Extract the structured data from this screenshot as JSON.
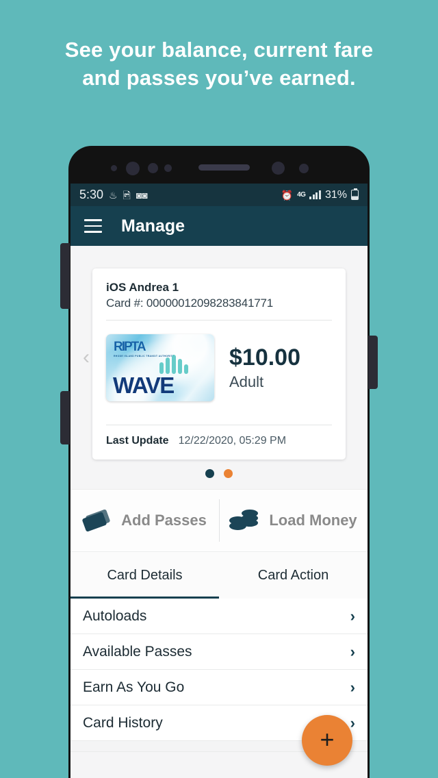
{
  "promo": {
    "line1": "See your balance, current fare",
    "line2": "and passes you’ve earned.",
    "background_color": "#5fb9ba"
  },
  "status_bar": {
    "time": "5:30",
    "left_icons": [
      "hotspot-icon",
      "image-icon",
      "incognito-icon"
    ],
    "alarm_icon": "alarm-icon",
    "network": "4G",
    "signal_icon": "signal-bars-icon",
    "battery_percent": "31%"
  },
  "app_bar": {
    "menu_icon": "hamburger-menu-icon",
    "title": "Manage",
    "background_color": "#16404f"
  },
  "card": {
    "name": "iOS Andrea 1",
    "number_label": "Card #: 00000012098283841771",
    "art": {
      "brand": "RIPTA",
      "brand_subtitle": "RHODE ISLAND PUBLIC TRANSIT AUTHORITY",
      "wordmark": "WAVE"
    },
    "balance": "$10.00",
    "fare_type": "Adult",
    "last_update_label": "Last Update",
    "last_update_value": "12/22/2020, 05:29 PM",
    "prev_arrow": "chevron-left-icon"
  },
  "pager": {
    "dots": [
      {
        "state": "inactive",
        "color": "#16404f"
      },
      {
        "state": "active",
        "color": "#ea8234"
      }
    ]
  },
  "actions": [
    {
      "label": "Add Passes",
      "icon": "ticket-icon"
    },
    {
      "label": "Load Money",
      "icon": "coins-icon"
    }
  ],
  "tabs": [
    {
      "label": "Card Details",
      "active": true
    },
    {
      "label": "Card Action",
      "active": false
    }
  ],
  "list": [
    {
      "label": "Autoloads",
      "chevron": "›"
    },
    {
      "label": "Available Passes",
      "chevron": "›"
    },
    {
      "label": "Earn As You Go",
      "chevron": "›"
    },
    {
      "label": "Card History",
      "chevron": "›"
    }
  ],
  "fab": {
    "icon": "plus-icon",
    "symbol": "+",
    "color": "#ea8234"
  }
}
